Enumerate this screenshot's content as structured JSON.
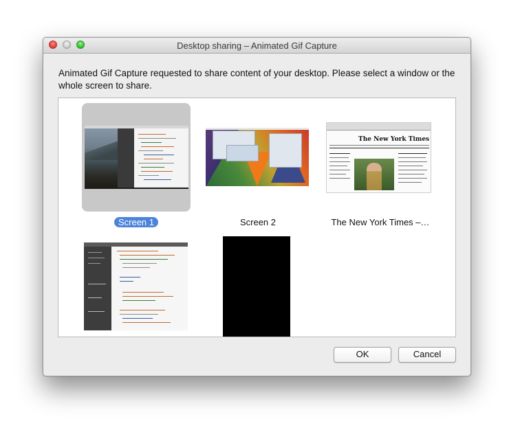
{
  "window": {
    "title": "Desktop sharing – Animated Gif Capture"
  },
  "message": "Animated Gif Capture requested to share content of your desktop. Please select a window or the whole screen to share.",
  "sources": [
    {
      "label": "Screen 1",
      "selected": true
    },
    {
      "label": "Screen 2",
      "selected": false
    },
    {
      "label": "The New York Times –…",
      "selected": false
    },
    {
      "label": "",
      "selected": false
    },
    {
      "label": "",
      "selected": false
    }
  ],
  "thumb_text": {
    "nyt_logo": "The New York Times"
  },
  "buttons": {
    "ok": "OK",
    "cancel": "Cancel"
  },
  "colors": {
    "selection": "#4d84da",
    "selected_tile": "#c8c8c8",
    "close": "#e0443e",
    "minimize": "#cfcfcf",
    "zoom": "#38c33a"
  }
}
